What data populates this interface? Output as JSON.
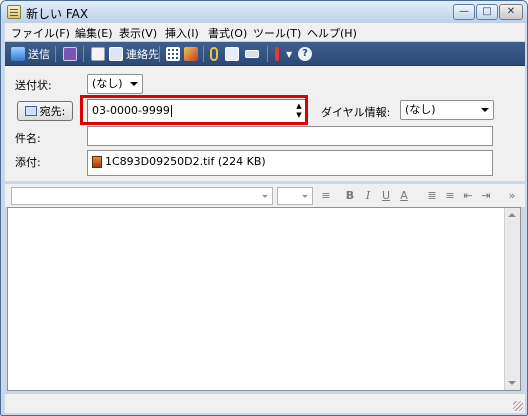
{
  "window": {
    "title": "新しい FAX"
  },
  "menu": [
    "ファイル(F)",
    "編集(E)",
    "表示(V)",
    "挿入(I)",
    "書式(O)",
    "ツール(T)",
    "ヘルプ(H)"
  ],
  "toolbar": {
    "send_label": "送信",
    "contacts_label": "連絡先",
    "help_glyph": "?"
  },
  "form": {
    "sender_label": "送付状:",
    "sender_value": "(なし)",
    "to_button_label": "宛先:",
    "to_value": "03-0000-9999",
    "dialing_label": "ダイヤル情報:",
    "dialing_value": "(なし)",
    "subject_label": "件名:",
    "subject_value": "",
    "attach_label": "添付:",
    "attachment_name": "1C893D09250D2.tif (224 KB)"
  },
  "format": {
    "bold": "B",
    "italic": "I",
    "underline": "U",
    "font_color": "A",
    "more": "»"
  },
  "colors": {
    "highlight": "#e00000",
    "toolbar": "#2b4a76"
  }
}
